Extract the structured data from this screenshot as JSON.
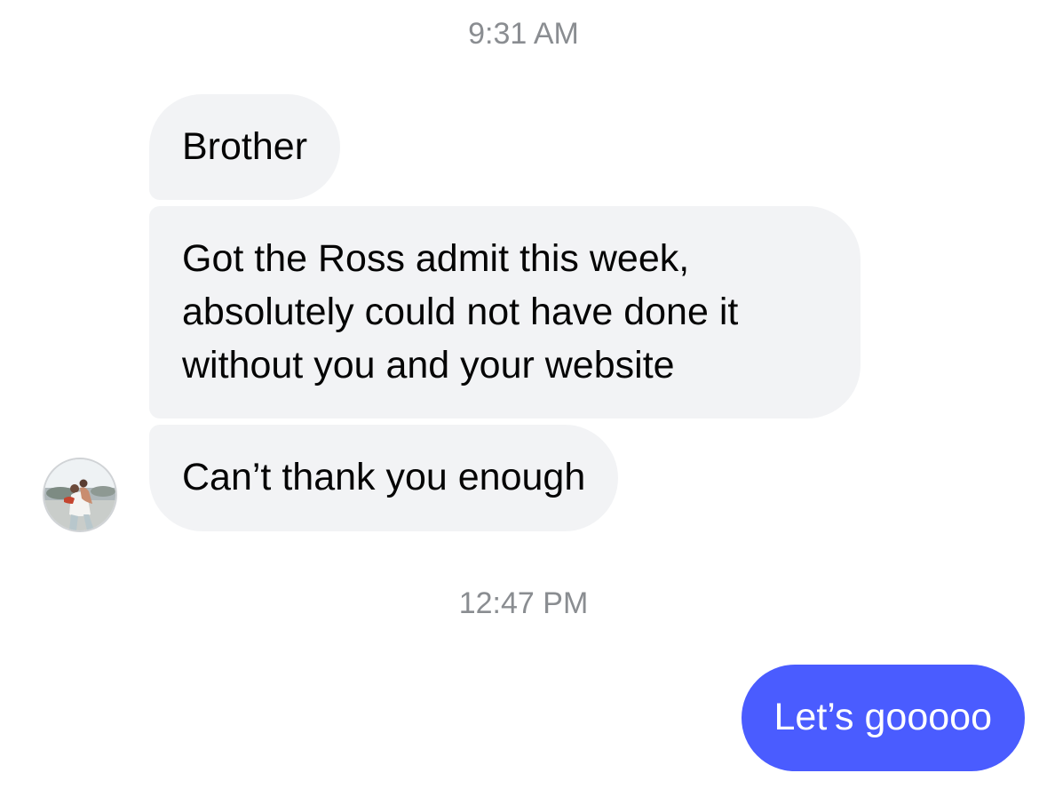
{
  "conversation": {
    "timestamps": [
      "9:31 AM",
      "12:47 PM"
    ],
    "incoming": [
      "Brother",
      "Got the Ross admit this week,",
      "absolutely could not have done it",
      "without you and your website",
      "Can’t thank you enough"
    ],
    "outgoing": [
      "Let’s gooooo"
    ],
    "avatar_icon": "contact-photo-avatar"
  },
  "colors": {
    "incoming_bubble": "#f2f3f5",
    "outgoing_bubble": "#4a5cff",
    "timestamp_text": "#8a8d91"
  }
}
